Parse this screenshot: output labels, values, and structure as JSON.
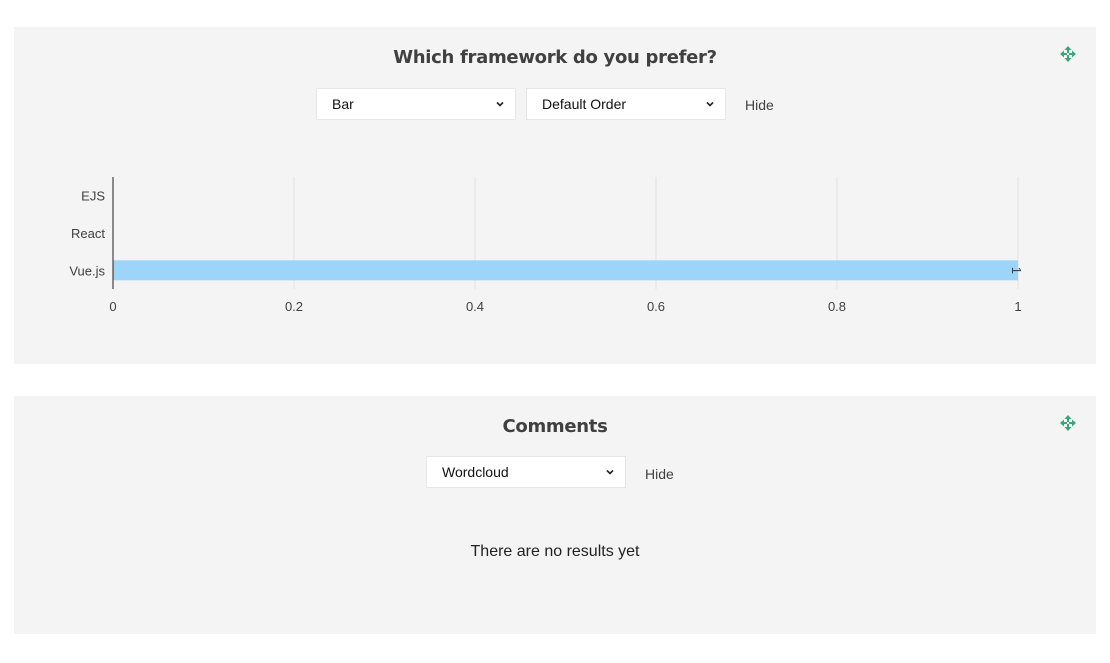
{
  "chart_panel": {
    "title": "Which framework do you prefer?",
    "chart_type_select": "Bar",
    "order_select": "Default Order",
    "hide_label": "Hide",
    "drag_icon": "move-arrows-icon"
  },
  "comments_panel": {
    "title": "Comments",
    "view_select": "Wordcloud",
    "hide_label": "Hide",
    "empty_message": "There are no results yet",
    "drag_icon": "move-arrows-icon"
  },
  "colors": {
    "panel_bg": "#f4f4f5",
    "bar": "#9cd4fa",
    "accent_icon": "#3aa57a"
  },
  "chart_data": {
    "type": "bar",
    "orientation": "horizontal",
    "categories": [
      "EJS",
      "React",
      "Vue.js"
    ],
    "values": [
      0,
      0,
      1
    ],
    "data_labels": [
      "",
      "",
      "1"
    ],
    "xlim": [
      0,
      1
    ],
    "x_ticks": [
      "0",
      "0.2",
      "0.4",
      "0.6",
      "0.8",
      "1"
    ],
    "grid": true,
    "title": "",
    "xlabel": "",
    "ylabel": ""
  }
}
